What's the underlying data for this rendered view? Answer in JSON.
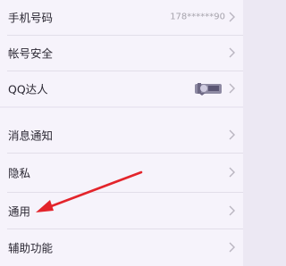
{
  "accountGroup": [
    {
      "label": "手机号码",
      "value": "178******90"
    },
    {
      "label": "帐号安全"
    },
    {
      "label": "QQ达人",
      "badge": "qq-expert-badge-icon"
    }
  ],
  "settingsGroup": [
    {
      "label": "消息通知"
    },
    {
      "label": "隐私"
    },
    {
      "label": "通用"
    },
    {
      "label": "辅助功能"
    }
  ],
  "colors": {
    "background": "#ece8f3",
    "rowBackground": "#f6f3fb",
    "text": "#2b2833",
    "secondaryText": "#a7a4ad",
    "annotationArrow": "#e3242b"
  },
  "icons": {
    "chevron": "chevron-right-icon",
    "annotation": "red-arrow-annotation"
  }
}
